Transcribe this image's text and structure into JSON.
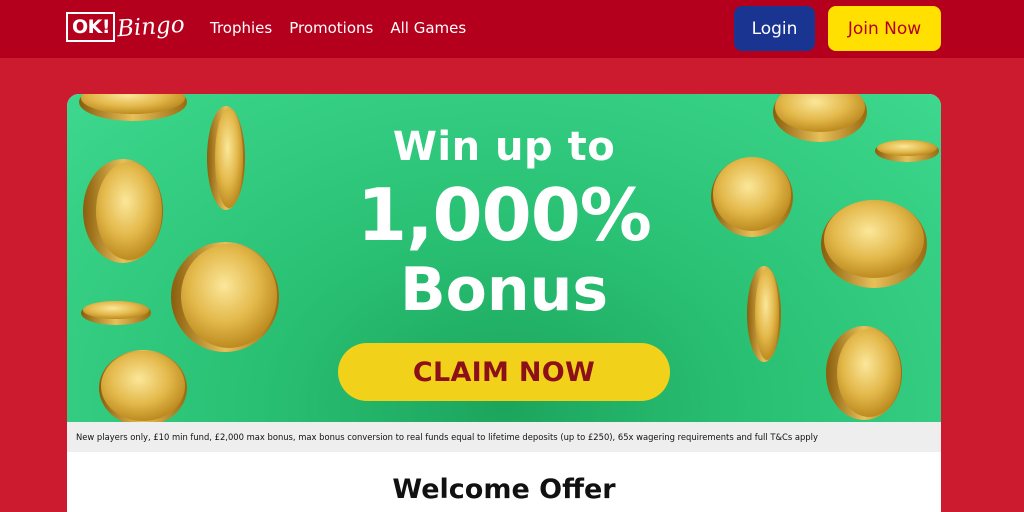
{
  "header": {
    "logo_box": "OK!",
    "logo_script": "Bingo",
    "nav": [
      "Trophies",
      "Promotions",
      "All Games"
    ],
    "login_label": "Login",
    "join_label": "Join Now"
  },
  "hero": {
    "line1": "Win up to",
    "line2": "1,000%",
    "line3": "Bonus",
    "cta_label": "CLAIM NOW"
  },
  "terms": "New players only, £10 min fund, £2,000 max bonus, max bonus conversion to real funds equal to lifetime deposits (up to £250), 65x wagering requirements and full T&Cs apply",
  "welcome_heading": "Welcome Offer",
  "colors": {
    "header_bg": "#b5001d",
    "page_bg": "#cc1a2e",
    "login_bg": "#1a3591",
    "join_bg": "#ffe000",
    "hero_green": "#29c073",
    "cta_bg": "#f2d11a",
    "cta_text": "#8c1018"
  },
  "icons": [
    "gold-coin-icon"
  ]
}
